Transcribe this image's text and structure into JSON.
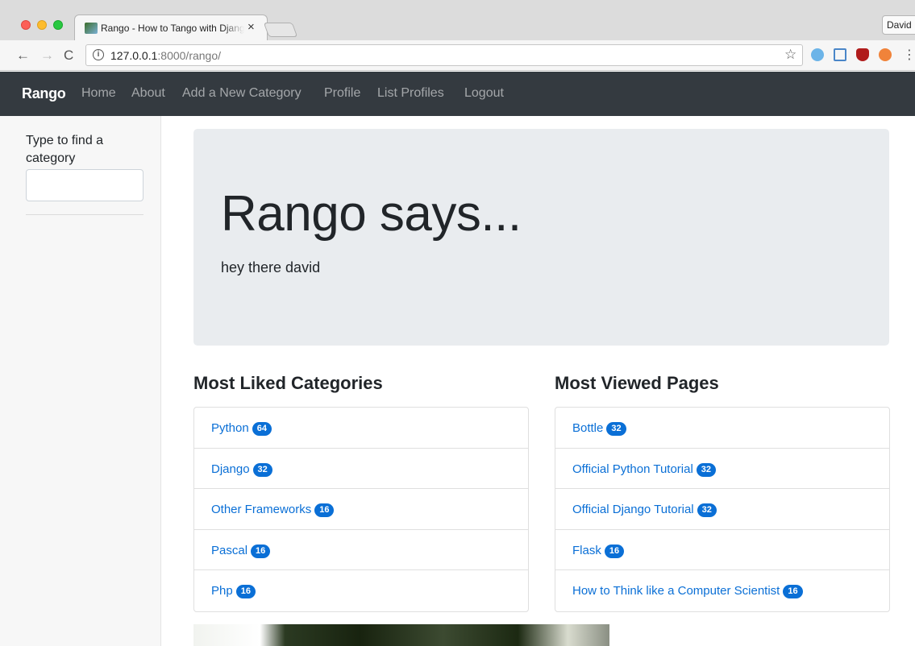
{
  "browser": {
    "tab_title": "Rango - How to Tango with Django",
    "tab_close": "×",
    "profile_name": "David",
    "url_host": "127.0.0.1",
    "url_rest": ":8000/rango/"
  },
  "icons": {
    "back": "←",
    "forward": "→",
    "reload": "C",
    "info": "i",
    "star": "☆",
    "menu": "⋮"
  },
  "navbar": {
    "brand": "Rango",
    "links": [
      "Home",
      "About",
      "Add a New Category",
      "Profile",
      "List Profiles",
      "Logout"
    ]
  },
  "sidebar": {
    "search_label": "Type to find a category",
    "search_value": ""
  },
  "jumbotron": {
    "title": "Rango says...",
    "subtitle": "hey there david"
  },
  "liked": {
    "heading": "Most Liked Categories",
    "items": [
      {
        "name": "Python",
        "count": "64"
      },
      {
        "name": "Django",
        "count": "32"
      },
      {
        "name": "Other Frameworks",
        "count": "16"
      },
      {
        "name": "Pascal",
        "count": "16"
      },
      {
        "name": "Php",
        "count": "16"
      }
    ]
  },
  "viewed": {
    "heading": "Most Viewed Pages",
    "items": [
      {
        "name": "Bottle",
        "count": "32"
      },
      {
        "name": "Official Python Tutorial",
        "count": "32"
      },
      {
        "name": "Official Django Tutorial",
        "count": "32"
      },
      {
        "name": "Flask",
        "count": "16"
      },
      {
        "name": "How to Think like a Computer Scientist",
        "count": "16"
      }
    ]
  }
}
